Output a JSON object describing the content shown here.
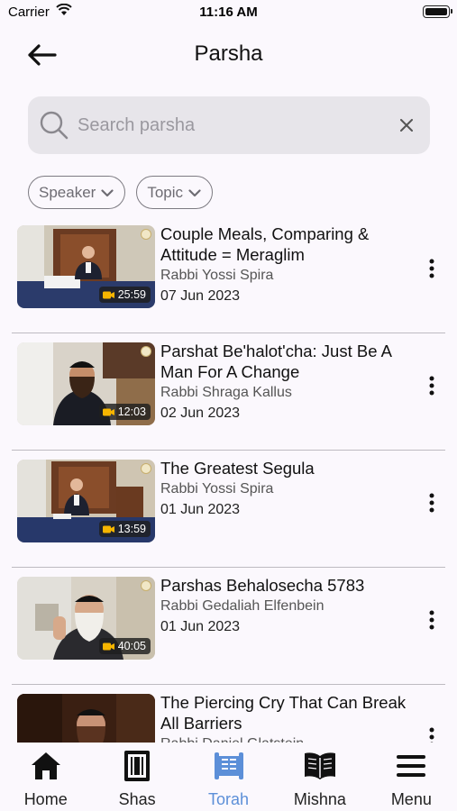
{
  "status_bar": {
    "carrier": "Carrier",
    "time": "11:16 AM"
  },
  "header": {
    "title": "Parsha"
  },
  "search": {
    "placeholder": "Search parsha",
    "value": ""
  },
  "filters": [
    {
      "label": "Speaker"
    },
    {
      "label": "Topic"
    }
  ],
  "lectures": [
    {
      "title": "Couple Meals, Comparing & Attitude = Meraglim",
      "speaker": "Rabbi Yossi Spira",
      "date": "07 Jun 2023",
      "duration": "25:59"
    },
    {
      "title": "Parshat Be'halot'cha: Just Be A Man For A Change",
      "speaker": "Rabbi Shraga Kallus",
      "date": "02 Jun 2023",
      "duration": "12:03"
    },
    {
      "title": "The Greatest Segula",
      "speaker": "Rabbi Yossi Spira",
      "date": "01 Jun 2023",
      "duration": "13:59"
    },
    {
      "title": "Parshas Behalosecha 5783",
      "speaker": "Rabbi Gedaliah Elfenbein",
      "date": "01 Jun 2023",
      "duration": "40:05"
    },
    {
      "title": "The Piercing Cry That Can Break All Barriers",
      "speaker": "Rabbi Daniel Glatstein",
      "date": "",
      "duration": ""
    }
  ],
  "tabs": [
    {
      "label": "Home",
      "icon": "home-icon",
      "active": false
    },
    {
      "label": "Shas",
      "icon": "shas-icon",
      "active": false
    },
    {
      "label": "Torah",
      "icon": "torah-scroll-icon",
      "active": true
    },
    {
      "label": "Mishna",
      "icon": "open-book-icon",
      "active": false
    },
    {
      "label": "Menu",
      "icon": "hamburger-menu-icon",
      "active": false
    }
  ],
  "colors": {
    "active_tab": "#5c8fd8",
    "background": "#fbf8fd",
    "search_bg": "#e7e5ea",
    "duration_icon": "#f6b500"
  }
}
